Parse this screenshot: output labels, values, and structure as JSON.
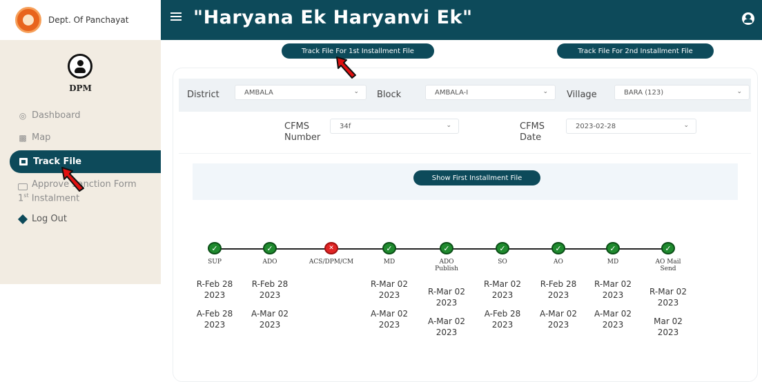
{
  "sidebar": {
    "brand": "Dept. Of Panchayat",
    "role": "DPM",
    "items": {
      "dashboard": "Dashboard",
      "map": "Map",
      "track_file": "Track File",
      "approve_line1": "Approve Sanction Form",
      "approve_line2_num": "1",
      "approve_line2_sup": "st",
      "approve_line2_rest": " Instalment",
      "logout": "Log Out"
    }
  },
  "header": {
    "title": "\"Haryana Ek Haryanvi Ek\""
  },
  "actions": {
    "first_installment": "Track File For 1st Installment File",
    "second_installment": "Track File For 2nd Installment File",
    "show_first": "Show First Installment File"
  },
  "filters": {
    "district_label": "District",
    "district_value": "AMBALA",
    "block_label": "Block",
    "block_value": "AMBALA-I",
    "village_label": "Village",
    "village_value": "BARA (123)",
    "cfms_number_label_1": "CFMS",
    "cfms_number_label_2": "Number",
    "cfms_number_value": "34f",
    "cfms_date_label_1": "CFMS",
    "cfms_date_label_2": "Date",
    "cfms_date_value": "2023-02-28"
  },
  "timeline": [
    {
      "stage": "SUP",
      "sub": "",
      "status": "done",
      "r1": "R-Feb 28",
      "r2": "2023",
      "a1": "A-Feb 28",
      "a2": "2023"
    },
    {
      "stage": "ADO",
      "sub": "",
      "status": "done",
      "r1": "R-Feb 28",
      "r2": "2023",
      "a1": "A-Mar 02",
      "a2": "2023"
    },
    {
      "stage": "ACS/DPM/CM",
      "sub": "",
      "status": "rejected",
      "r1": "",
      "r2": "",
      "a1": "",
      "a2": ""
    },
    {
      "stage": "MD",
      "sub": "",
      "status": "done",
      "r1": "R-Mar 02",
      "r2": "2023",
      "a1": "A-Mar 02",
      "a2": "2023"
    },
    {
      "stage": "ADO",
      "sub": "Publish",
      "status": "done",
      "r1": "R-Mar 02",
      "r2": "2023",
      "a1": "A-Mar 02",
      "a2": "2023"
    },
    {
      "stage": "SO",
      "sub": "",
      "status": "done",
      "r1": "R-Mar 02",
      "r2": "2023",
      "a1": "A-Feb 28",
      "a2": "2023"
    },
    {
      "stage": "AO",
      "sub": "",
      "status": "done",
      "r1": "R-Feb 28",
      "r2": "2023",
      "a1": "A-Mar 02",
      "a2": "2023"
    },
    {
      "stage": "MD",
      "sub": "",
      "status": "done",
      "r1": "R-Mar 02",
      "r2": "2023",
      "a1": "A-Mar 02",
      "a2": "2023"
    },
    {
      "stage": "AO Mail",
      "sub": "Send",
      "status": "done",
      "r1": "R-Mar 02",
      "r2": "2023",
      "a1": "Mar 02",
      "a2": "2023"
    }
  ],
  "icons": {
    "done": "check-icon",
    "rejected": "cross-icon"
  },
  "colors": {
    "primary": "#0d4a5a",
    "done": "#1f8a2e",
    "rejected": "#e02424",
    "sidebar_bg": "#f2ece2",
    "pointer": "#e01010"
  }
}
